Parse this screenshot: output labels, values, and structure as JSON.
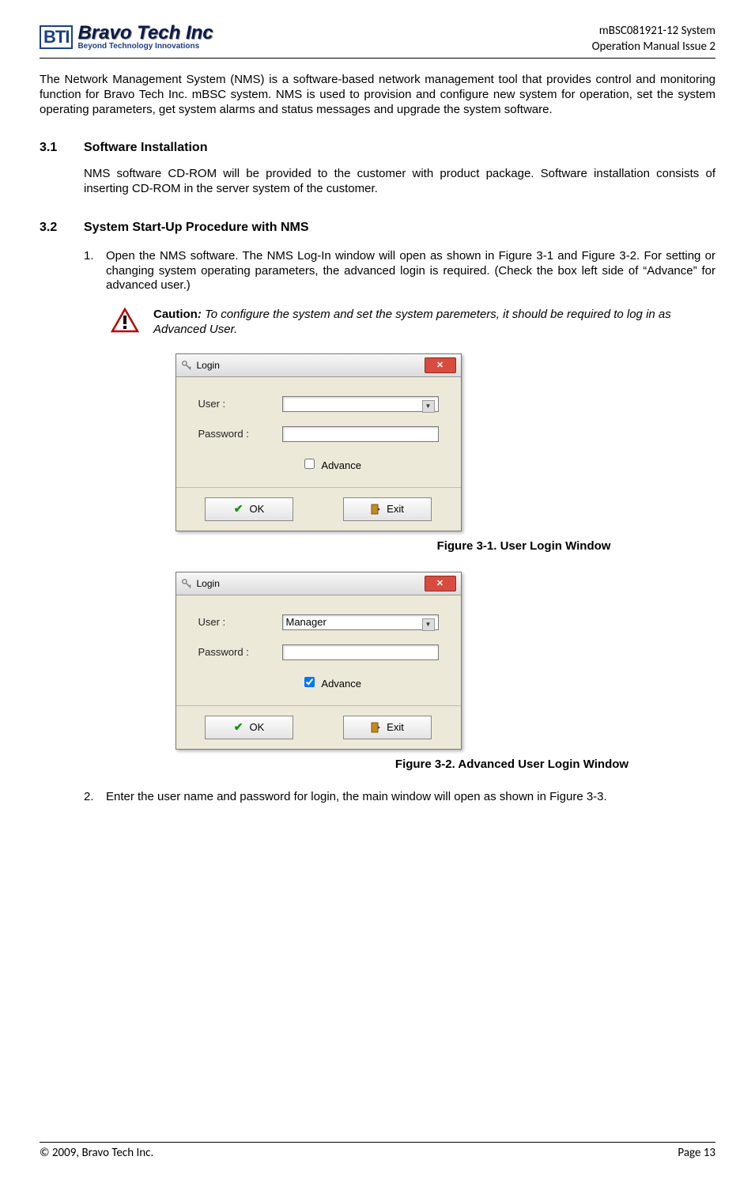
{
  "header": {
    "logo_mark": "BTI",
    "logo_main": "Bravo Tech Inc",
    "logo_tag": "Beyond Technology Innovations",
    "meta_line1": "mBSC081921-12 System",
    "meta_line2": "Operation Manual Issue 2"
  },
  "intro": "The Network Management System (NMS) is a software-based network management tool that provides control and monitoring function for Bravo Tech Inc. mBSC system. NMS is used to provision and configure new system for operation, set the system operating parameters, get system alarms and status messages and upgrade the system software.",
  "sections": {
    "s31_num": "3.1",
    "s31_title": "Software Installation",
    "s31_body": "NMS software CD-ROM will be provided to the customer with product package. Software installation consists of inserting CD-ROM in the server system of the customer.",
    "s32_num": "3.2",
    "s32_title": "System Start-Up Procedure with NMS"
  },
  "list": {
    "i1_num": "1.",
    "i1_text": "Open the NMS software. The NMS Log-In window will open as shown in Figure 3-1 and Figure 3-2. For setting or changing system operating parameters, the advanced login is required. (Check the box left side of “Advance” for advanced user.)",
    "i2_num": "2.",
    "i2_text": "Enter the user name and password for login, the main window will open as shown in Figure 3-3."
  },
  "caution": {
    "label": "Caution",
    "colon": ":",
    "text": " To configure the system and set the system paremeters, it should be required to log in as Advanced User."
  },
  "dialog": {
    "title": "Login",
    "user_label": "User :",
    "password_label": "Password :",
    "advance_label": "Advance",
    "ok_label": "OK",
    "exit_label": "Exit",
    "user_value_fig2": "Manager"
  },
  "captions": {
    "fig31": "Figure 3-1. User Login Window",
    "fig32": "Figure 3-2. Advanced User Login Window"
  },
  "footer": {
    "left": "© 2009, Bravo Tech Inc.",
    "right": "Page 13"
  }
}
